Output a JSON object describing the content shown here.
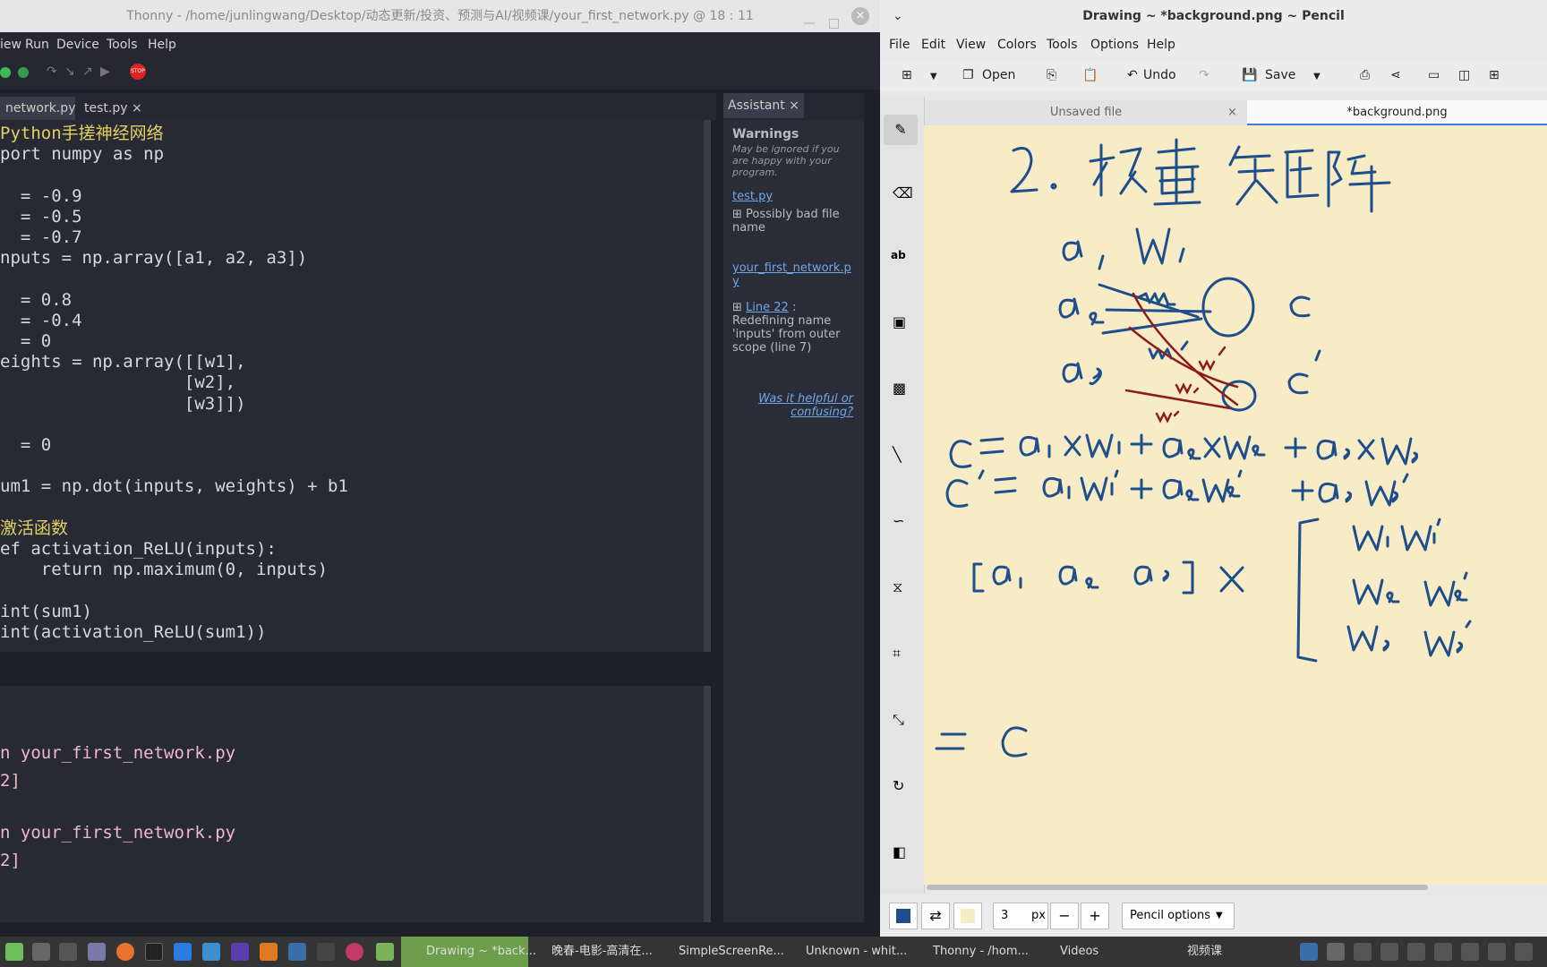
{
  "thonny": {
    "title": "Thonny  -  /home/junlingwang/Desktop/动态更新/投资、预测与AI/视频课/your_first_network.py  @  18 : 11",
    "menu": [
      "iew",
      "Run",
      "Device",
      "Tools",
      "Help"
    ],
    "tabs": [
      {
        "label": "network.py",
        "close": "×"
      },
      {
        "label": "test.py",
        "close": "×"
      }
    ],
    "stop_label": "STOP",
    "code": [
      [
        "c-yel",
        "Python手搓神经网络"
      ],
      [
        "",
        "port numpy as np"
      ],
      [
        "",
        ""
      ],
      [
        "",
        "  = -0.9"
      ],
      [
        "",
        "  = -0.5"
      ],
      [
        "",
        "  = -0.7"
      ],
      [
        "",
        "nputs = np.array([a1, a2, a3])"
      ],
      [
        "",
        ""
      ],
      [
        "",
        "  = 0.8"
      ],
      [
        "",
        "  = -0.4"
      ],
      [
        "",
        "  = 0"
      ],
      [
        "",
        "eights = np.array([[w1],"
      ],
      [
        "",
        "                  [w2],"
      ],
      [
        "",
        "                  [w3]])"
      ],
      [
        "",
        ""
      ],
      [
        "",
        "  = 0"
      ],
      [
        "",
        ""
      ],
      [
        "",
        "um1 = np.dot(inputs, weights) + b1"
      ],
      [
        "",
        ""
      ],
      [
        "c-yel",
        "激活函数"
      ],
      [
        "",
        "ef activation_ReLU(inputs):"
      ],
      [
        "",
        "    return np.maximum(0, inputs)"
      ],
      [
        "",
        ""
      ],
      [
        "",
        "int(sum1)"
      ],
      [
        "",
        "int(activation_ReLU(sum1))"
      ]
    ],
    "shell": [
      "n your_first_network.py",
      "2]",
      "n your_first_network.py",
      "2]"
    ],
    "assistant": {
      "tab": "Assistant",
      "close": "×",
      "heading": "Warnings",
      "subtitle": "May be ignored if you are happy with your program.",
      "file1": "test.py",
      "item1": "Possibly bad file name",
      "file2": "your_first_network.py",
      "item2_link": "Line 22",
      "item2_text": " : Redefining name 'inputs' from outer scope (line 7)",
      "feedback": "Was it helpful or confusing?"
    }
  },
  "pencil": {
    "title": "Drawing ~ *background.png ~ Pencil",
    "menu": [
      "File",
      "Edit",
      "View",
      "Colors",
      "Tools",
      "Options",
      "Help"
    ],
    "toolbar": {
      "open": "Open",
      "undo": "Undo",
      "save": "Save"
    },
    "tabs": {
      "unsaved": "Unsaved file",
      "active": "*background.png",
      "close": "×"
    },
    "size_value": "3",
    "size_unit": "px",
    "minus": "−",
    "plus": "+",
    "options": "Pencil options",
    "colors": {
      "primary": "#1f4e8c",
      "secondary": "#f7ecc6"
    }
  },
  "taskbar": {
    "items": [
      "Drawing ~ *back...",
      "晚春-电影-高清在...",
      "SimpleScreenRe...",
      "Unknown - whit...",
      "Thonny  - /hom...",
      "Videos",
      "视频课"
    ]
  }
}
